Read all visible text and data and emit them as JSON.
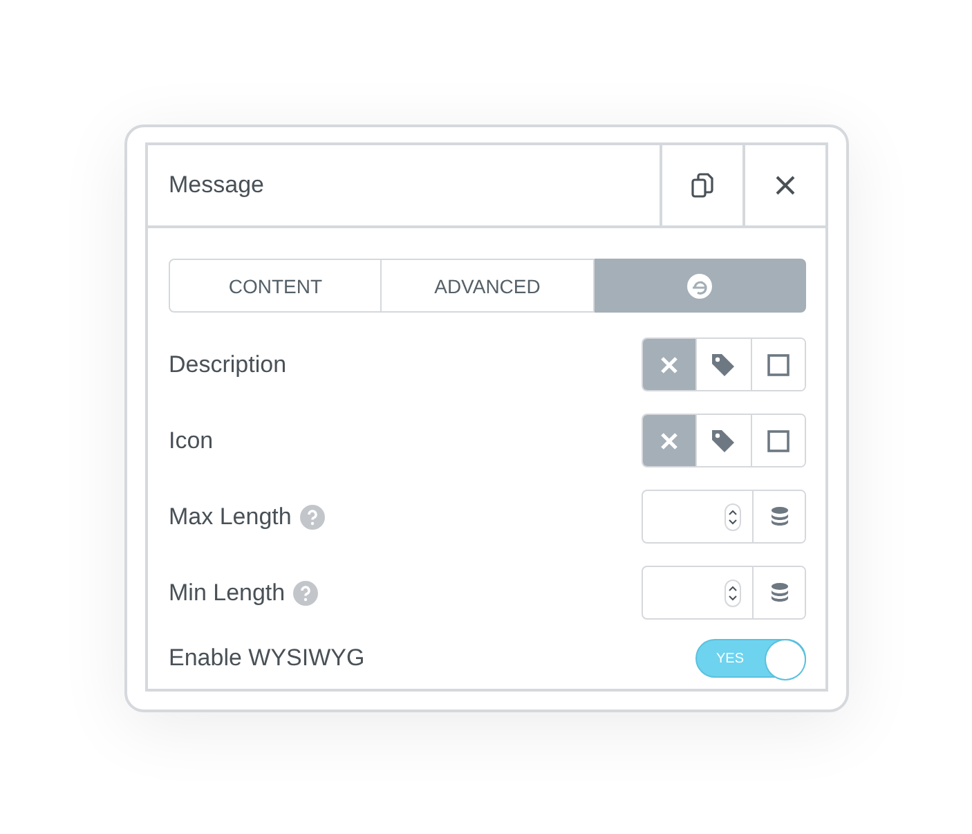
{
  "panel": {
    "title": "Message"
  },
  "tabs": [
    {
      "kind": "text",
      "label": "CONTENT",
      "selected": false
    },
    {
      "kind": "text",
      "label": "ADVANCED",
      "selected": false
    },
    {
      "kind": "logo",
      "selected": true
    }
  ],
  "rows": [
    {
      "kind": "choice",
      "label": "Description",
      "options": [
        {
          "selected": true
        },
        {
          "selected": false
        },
        {
          "selected": false
        }
      ]
    },
    {
      "kind": "choice",
      "label": "Icon",
      "options": [
        {
          "selected": true
        },
        {
          "selected": false
        },
        {
          "selected": false
        }
      ]
    },
    {
      "kind": "number",
      "label": "Max Length",
      "help": true
    },
    {
      "kind": "number",
      "label": "Min Length",
      "help": true
    },
    {
      "kind": "switch",
      "label": "Enable WYSIWYG",
      "on": true,
      "switch_label": "YES"
    }
  ]
}
